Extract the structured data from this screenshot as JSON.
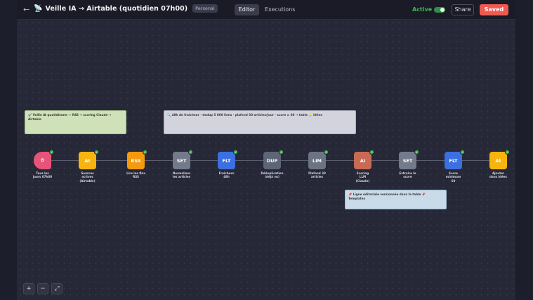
{
  "header": {
    "back_icon": "arrow-left-icon",
    "title_icon": "satellite-antenna-icon",
    "title_glyph": "📡",
    "title": "Veille IA → Airtable (quotidien 07h00)",
    "badge": "Personal",
    "tabs": [
      {
        "label": "Editor"
      },
      {
        "label": "Executions"
      }
    ],
    "active_label": "Active",
    "active": true,
    "share_label": "Share",
    "saved_label": "Saved",
    "colors": {
      "accent": "#ee5a52",
      "active": "#3fb950"
    }
  },
  "stickies": [
    {
      "text": "✔️ Veille IA quotidienne — RSS → scoring Claude → Airtable",
      "color": "#cfe1b8"
    },
    {
      "text": "🔍 48h de fraîcheur · dedup 5 000 liens · plafond 30 articles/jour · score ≥ 60 → table 💡 Idées",
      "color": "#d2d3dc"
    },
    {
      "text": "📌 Ligne éditoriale versionnée dans la table 📌 Templates",
      "color": "#c9dbe9"
    }
  ],
  "nodes": [
    {
      "icon": "⏲",
      "label_lines": [
        "Tous les",
        "jours 07h00"
      ],
      "color": "#e8537a"
    },
    {
      "icon": "At",
      "label_lines": [
        "Sources",
        "actives",
        "(Airtable)"
      ],
      "color": "#f5b40e"
    },
    {
      "icon": "RSS",
      "label_lines": [
        "Lire les flux",
        "RSS"
      ],
      "color": "#f59a0e"
    },
    {
      "icon": "SET",
      "label_lines": [
        "Normaliser",
        "les articles"
      ],
      "color": "#737a8a"
    },
    {
      "icon": "FLT",
      "label_lines": [
        "Fraîcheur",
        "48h"
      ],
      "color": "#3c6fe0"
    },
    {
      "icon": "DUP",
      "label_lines": [
        "Déduplication",
        "(déjà vu)"
      ],
      "color": "#5d6576"
    },
    {
      "icon": "LIM",
      "label_lines": [
        "Plafond 30",
        "articles"
      ],
      "color": "#6c7383"
    },
    {
      "icon": "AI",
      "label_lines": [
        "Scoring",
        "LLM",
        "(Claude)"
      ],
      "color": "#c96a55"
    },
    {
      "icon": "SET",
      "label_lines": [
        "Extraire le",
        "score"
      ],
      "color": "#737a8a"
    },
    {
      "icon": "FLT",
      "label_lines": [
        "Score",
        "minimum",
        "60"
      ],
      "color": "#3c6fe0"
    },
    {
      "icon": "At",
      "label_lines": [
        "Ajouter",
        "dans Idées"
      ],
      "color": "#f5b40e"
    }
  ],
  "zoom_controls": [
    {
      "glyph": "+",
      "icon": "zoom-in-icon"
    },
    {
      "glyph": "−",
      "icon": "zoom-out-icon"
    },
    {
      "glyph": "⤢",
      "icon": "fit-view-icon"
    }
  ]
}
